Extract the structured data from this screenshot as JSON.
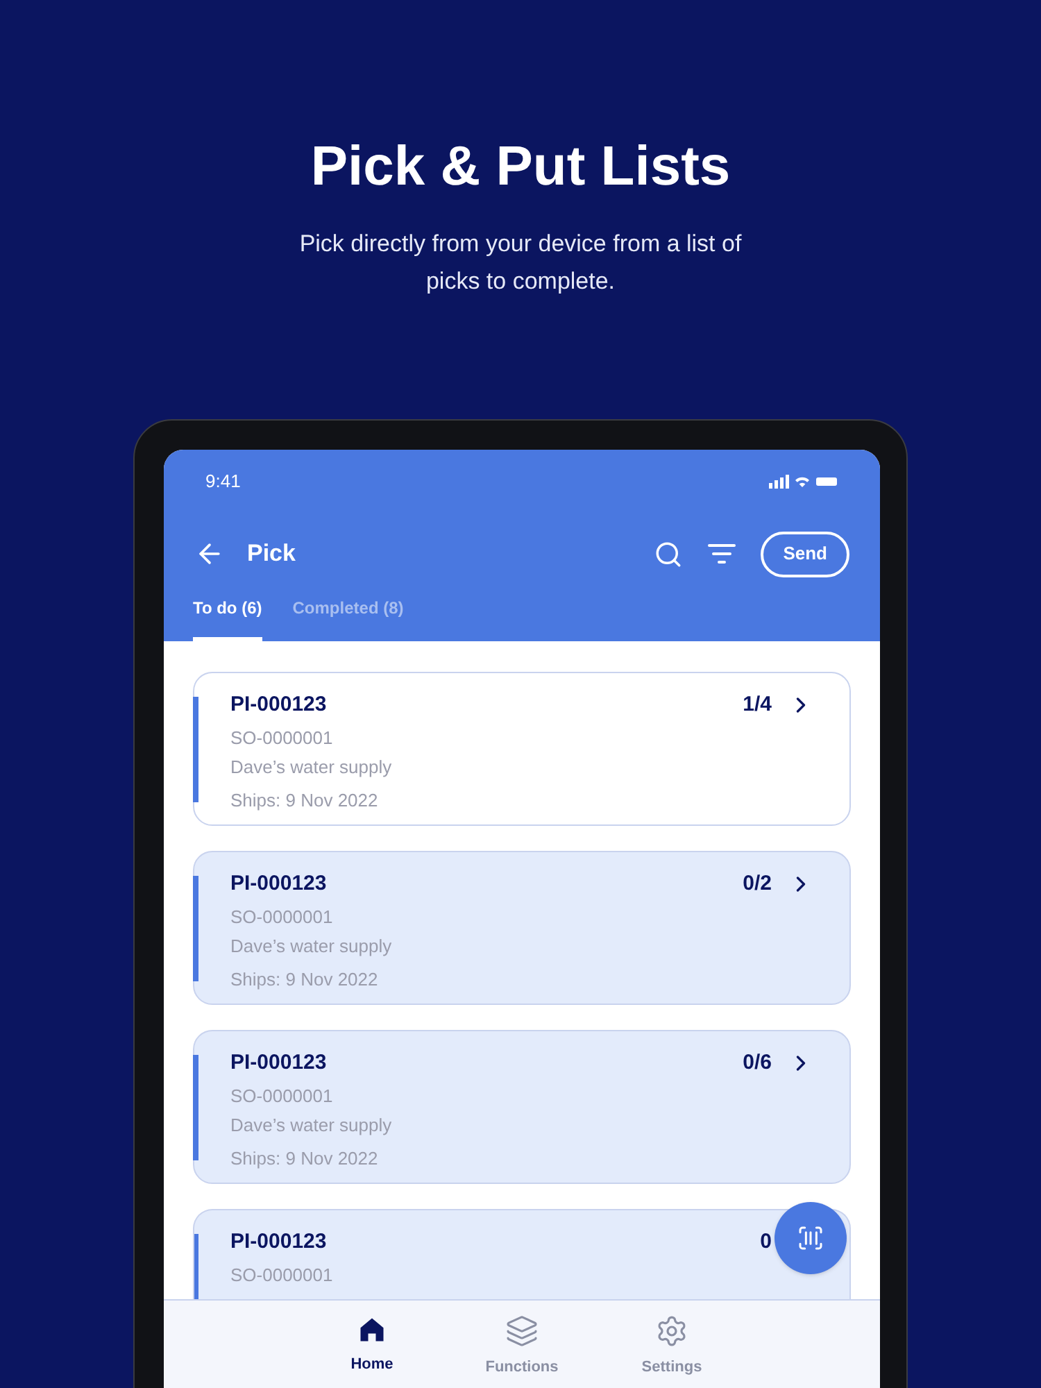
{
  "hero": {
    "title": "Pick & Put Lists",
    "subtitle": "Pick directly from your device from a list of picks to complete."
  },
  "status_bar": {
    "time": "9:41"
  },
  "header": {
    "title": "Pick",
    "send_button": "Send"
  },
  "tabs": [
    {
      "label": "To do (6)",
      "selected": true
    },
    {
      "label": "Completed (8)",
      "selected": false
    }
  ],
  "picks": [
    {
      "id": "PI-000123",
      "count": "1/4",
      "order": "SO-0000001",
      "customer": "Dave’s water supply",
      "ships": "Ships: 9 Nov 2022",
      "highlighted": false
    },
    {
      "id": "PI-000123",
      "count": "0/2",
      "order": "SO-0000001",
      "customer": "Dave’s water supply",
      "ships": "Ships: 9 Nov 2022",
      "highlighted": true
    },
    {
      "id": "PI-000123",
      "count": "0/6",
      "order": "SO-0000001",
      "customer": "Dave’s water supply",
      "ships": "Ships: 9 Nov 2022",
      "highlighted": true
    },
    {
      "id": "PI-000123",
      "count": "0",
      "order": "SO-0000001",
      "highlighted": true
    }
  ],
  "bottom_nav": [
    {
      "label": "Home",
      "kind": "home",
      "selected": true
    },
    {
      "label": "Functions",
      "kind": "layers",
      "selected": false
    },
    {
      "label": "Settings",
      "kind": "settings",
      "selected": false
    }
  ]
}
